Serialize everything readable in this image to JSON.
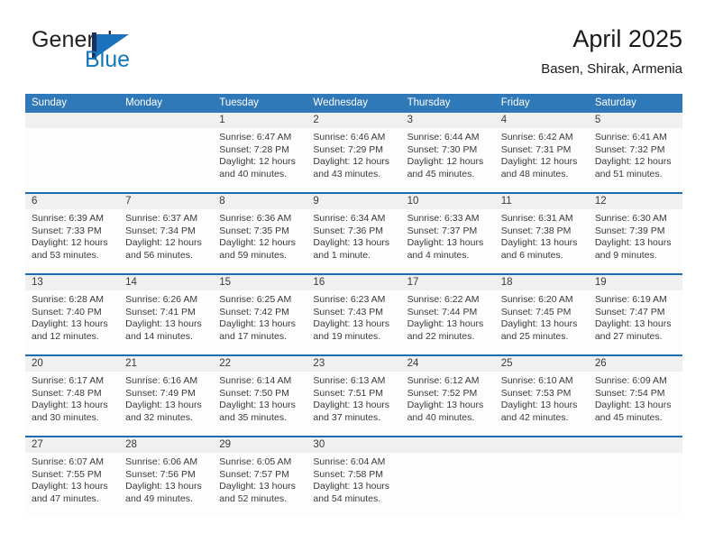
{
  "brand": {
    "name_part1": "General",
    "name_part2": "Blue",
    "mark_icon": "blue-flag-icon"
  },
  "header": {
    "title": "April 2025",
    "location": "Basen, Shirak, Armenia"
  },
  "colors": {
    "header_blue": "#3079b8",
    "week_rule_blue": "#1d6cb0",
    "daynum_band": "#f0f0f0",
    "brand_blue": "#1277bc",
    "brand_navy": "#18315c"
  },
  "weekdays": [
    "Sunday",
    "Monday",
    "Tuesday",
    "Wednesday",
    "Thursday",
    "Friday",
    "Saturday"
  ],
  "weeks": [
    [
      {
        "day": "",
        "sunrise": "",
        "sunset": "",
        "daylight_line1": "",
        "daylight_line2": ""
      },
      {
        "day": "",
        "sunrise": "",
        "sunset": "",
        "daylight_line1": "",
        "daylight_line2": ""
      },
      {
        "day": "1",
        "sunrise": "Sunrise: 6:47 AM",
        "sunset": "Sunset: 7:28 PM",
        "daylight_line1": "Daylight: 12 hours",
        "daylight_line2": "and 40 minutes."
      },
      {
        "day": "2",
        "sunrise": "Sunrise: 6:46 AM",
        "sunset": "Sunset: 7:29 PM",
        "daylight_line1": "Daylight: 12 hours",
        "daylight_line2": "and 43 minutes."
      },
      {
        "day": "3",
        "sunrise": "Sunrise: 6:44 AM",
        "sunset": "Sunset: 7:30 PM",
        "daylight_line1": "Daylight: 12 hours",
        "daylight_line2": "and 45 minutes."
      },
      {
        "day": "4",
        "sunrise": "Sunrise: 6:42 AM",
        "sunset": "Sunset: 7:31 PM",
        "daylight_line1": "Daylight: 12 hours",
        "daylight_line2": "and 48 minutes."
      },
      {
        "day": "5",
        "sunrise": "Sunrise: 6:41 AM",
        "sunset": "Sunset: 7:32 PM",
        "daylight_line1": "Daylight: 12 hours",
        "daylight_line2": "and 51 minutes."
      }
    ],
    [
      {
        "day": "6",
        "sunrise": "Sunrise: 6:39 AM",
        "sunset": "Sunset: 7:33 PM",
        "daylight_line1": "Daylight: 12 hours",
        "daylight_line2": "and 53 minutes."
      },
      {
        "day": "7",
        "sunrise": "Sunrise: 6:37 AM",
        "sunset": "Sunset: 7:34 PM",
        "daylight_line1": "Daylight: 12 hours",
        "daylight_line2": "and 56 minutes."
      },
      {
        "day": "8",
        "sunrise": "Sunrise: 6:36 AM",
        "sunset": "Sunset: 7:35 PM",
        "daylight_line1": "Daylight: 12 hours",
        "daylight_line2": "and 59 minutes."
      },
      {
        "day": "9",
        "sunrise": "Sunrise: 6:34 AM",
        "sunset": "Sunset: 7:36 PM",
        "daylight_line1": "Daylight: 13 hours",
        "daylight_line2": "and 1 minute."
      },
      {
        "day": "10",
        "sunrise": "Sunrise: 6:33 AM",
        "sunset": "Sunset: 7:37 PM",
        "daylight_line1": "Daylight: 13 hours",
        "daylight_line2": "and 4 minutes."
      },
      {
        "day": "11",
        "sunrise": "Sunrise: 6:31 AM",
        "sunset": "Sunset: 7:38 PM",
        "daylight_line1": "Daylight: 13 hours",
        "daylight_line2": "and 6 minutes."
      },
      {
        "day": "12",
        "sunrise": "Sunrise: 6:30 AM",
        "sunset": "Sunset: 7:39 PM",
        "daylight_line1": "Daylight: 13 hours",
        "daylight_line2": "and 9 minutes."
      }
    ],
    [
      {
        "day": "13",
        "sunrise": "Sunrise: 6:28 AM",
        "sunset": "Sunset: 7:40 PM",
        "daylight_line1": "Daylight: 13 hours",
        "daylight_line2": "and 12 minutes."
      },
      {
        "day": "14",
        "sunrise": "Sunrise: 6:26 AM",
        "sunset": "Sunset: 7:41 PM",
        "daylight_line1": "Daylight: 13 hours",
        "daylight_line2": "and 14 minutes."
      },
      {
        "day": "15",
        "sunrise": "Sunrise: 6:25 AM",
        "sunset": "Sunset: 7:42 PM",
        "daylight_line1": "Daylight: 13 hours",
        "daylight_line2": "and 17 minutes."
      },
      {
        "day": "16",
        "sunrise": "Sunrise: 6:23 AM",
        "sunset": "Sunset: 7:43 PM",
        "daylight_line1": "Daylight: 13 hours",
        "daylight_line2": "and 19 minutes."
      },
      {
        "day": "17",
        "sunrise": "Sunrise: 6:22 AM",
        "sunset": "Sunset: 7:44 PM",
        "daylight_line1": "Daylight: 13 hours",
        "daylight_line2": "and 22 minutes."
      },
      {
        "day": "18",
        "sunrise": "Sunrise: 6:20 AM",
        "sunset": "Sunset: 7:45 PM",
        "daylight_line1": "Daylight: 13 hours",
        "daylight_line2": "and 25 minutes."
      },
      {
        "day": "19",
        "sunrise": "Sunrise: 6:19 AM",
        "sunset": "Sunset: 7:47 PM",
        "daylight_line1": "Daylight: 13 hours",
        "daylight_line2": "and 27 minutes."
      }
    ],
    [
      {
        "day": "20",
        "sunrise": "Sunrise: 6:17 AM",
        "sunset": "Sunset: 7:48 PM",
        "daylight_line1": "Daylight: 13 hours",
        "daylight_line2": "and 30 minutes."
      },
      {
        "day": "21",
        "sunrise": "Sunrise: 6:16 AM",
        "sunset": "Sunset: 7:49 PM",
        "daylight_line1": "Daylight: 13 hours",
        "daylight_line2": "and 32 minutes."
      },
      {
        "day": "22",
        "sunrise": "Sunrise: 6:14 AM",
        "sunset": "Sunset: 7:50 PM",
        "daylight_line1": "Daylight: 13 hours",
        "daylight_line2": "and 35 minutes."
      },
      {
        "day": "23",
        "sunrise": "Sunrise: 6:13 AM",
        "sunset": "Sunset: 7:51 PM",
        "daylight_line1": "Daylight: 13 hours",
        "daylight_line2": "and 37 minutes."
      },
      {
        "day": "24",
        "sunrise": "Sunrise: 6:12 AM",
        "sunset": "Sunset: 7:52 PM",
        "daylight_line1": "Daylight: 13 hours",
        "daylight_line2": "and 40 minutes."
      },
      {
        "day": "25",
        "sunrise": "Sunrise: 6:10 AM",
        "sunset": "Sunset: 7:53 PM",
        "daylight_line1": "Daylight: 13 hours",
        "daylight_line2": "and 42 minutes."
      },
      {
        "day": "26",
        "sunrise": "Sunrise: 6:09 AM",
        "sunset": "Sunset: 7:54 PM",
        "daylight_line1": "Daylight: 13 hours",
        "daylight_line2": "and 45 minutes."
      }
    ],
    [
      {
        "day": "27",
        "sunrise": "Sunrise: 6:07 AM",
        "sunset": "Sunset: 7:55 PM",
        "daylight_line1": "Daylight: 13 hours",
        "daylight_line2": "and 47 minutes."
      },
      {
        "day": "28",
        "sunrise": "Sunrise: 6:06 AM",
        "sunset": "Sunset: 7:56 PM",
        "daylight_line1": "Daylight: 13 hours",
        "daylight_line2": "and 49 minutes."
      },
      {
        "day": "29",
        "sunrise": "Sunrise: 6:05 AM",
        "sunset": "Sunset: 7:57 PM",
        "daylight_line1": "Daylight: 13 hours",
        "daylight_line2": "and 52 minutes."
      },
      {
        "day": "30",
        "sunrise": "Sunrise: 6:04 AM",
        "sunset": "Sunset: 7:58 PM",
        "daylight_line1": "Daylight: 13 hours",
        "daylight_line2": "and 54 minutes."
      },
      {
        "day": "",
        "sunrise": "",
        "sunset": "",
        "daylight_line1": "",
        "daylight_line2": ""
      },
      {
        "day": "",
        "sunrise": "",
        "sunset": "",
        "daylight_line1": "",
        "daylight_line2": ""
      },
      {
        "day": "",
        "sunrise": "",
        "sunset": "",
        "daylight_line1": "",
        "daylight_line2": ""
      }
    ]
  ]
}
